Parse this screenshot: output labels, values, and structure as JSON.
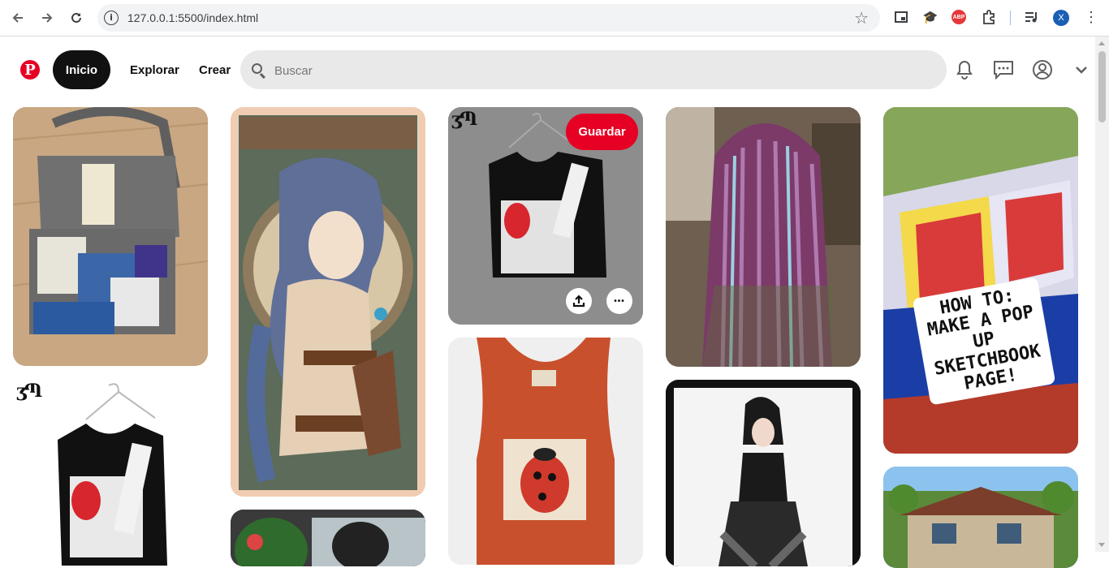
{
  "browser": {
    "url": "127.0.0.1:5500/index.html",
    "profile_initial": "X",
    "abp_label": "ABP"
  },
  "header": {
    "logo": "P",
    "home_label": "Inicio",
    "explore_label": "Explorar",
    "create_label": "Crear",
    "search_placeholder": "Buscar"
  },
  "pins": {
    "save_label": "Guardar",
    "more_label": "•••",
    "stamp_text": "ʒՊ",
    "poster_text": "HOW TO: MAKE A POP UP SKETCHBOOK PAGE!"
  },
  "colors": {
    "brand": "#e60023",
    "home_pill": "#111111",
    "search_bg": "#e9e9e9"
  },
  "icons": [
    "back-icon",
    "forward-icon",
    "reload-icon",
    "info-icon",
    "star-icon",
    "bell-icon",
    "chat-icon",
    "account-icon",
    "chevron-down-icon",
    "upload-icon",
    "more-icon"
  ]
}
